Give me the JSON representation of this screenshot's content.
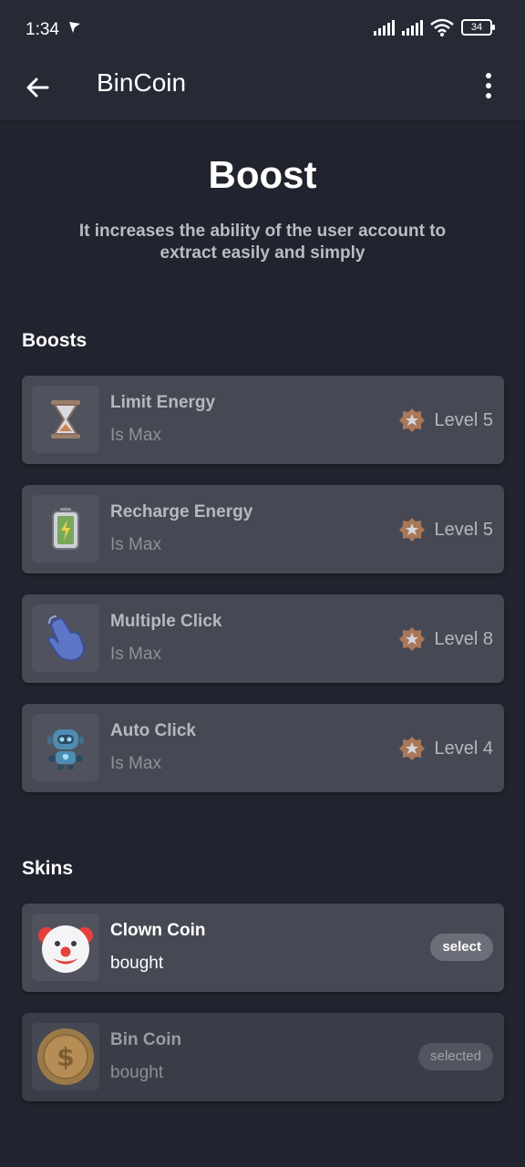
{
  "status": {
    "time": "1:34",
    "battery": "34"
  },
  "appbar": {
    "title": "BinCoin"
  },
  "header": {
    "title": "Boost",
    "subtitle": "It increases the ability of the user account to extract easily and simply"
  },
  "boosts": {
    "heading": "Boosts",
    "items": [
      {
        "name": "Limit Energy",
        "status": "Is Max",
        "level": "Level 5",
        "icon": "hourglass-icon"
      },
      {
        "name": "Recharge Energy",
        "status": "Is Max",
        "level": "Level 5",
        "icon": "battery-icon"
      },
      {
        "name": "Multiple Click",
        "status": "Is Max",
        "level": "Level 8",
        "icon": "hand-pointer-icon"
      },
      {
        "name": "Auto Click",
        "status": "Is Max",
        "level": "Level 4",
        "icon": "robot-icon"
      }
    ]
  },
  "skins": {
    "heading": "Skins",
    "items": [
      {
        "name": "Clown Coin",
        "status": "bought",
        "action": "select",
        "icon": "clown-icon"
      },
      {
        "name": "Bin Coin",
        "status": "bought",
        "action": "selected",
        "icon": "dollar-coin-icon"
      }
    ]
  }
}
